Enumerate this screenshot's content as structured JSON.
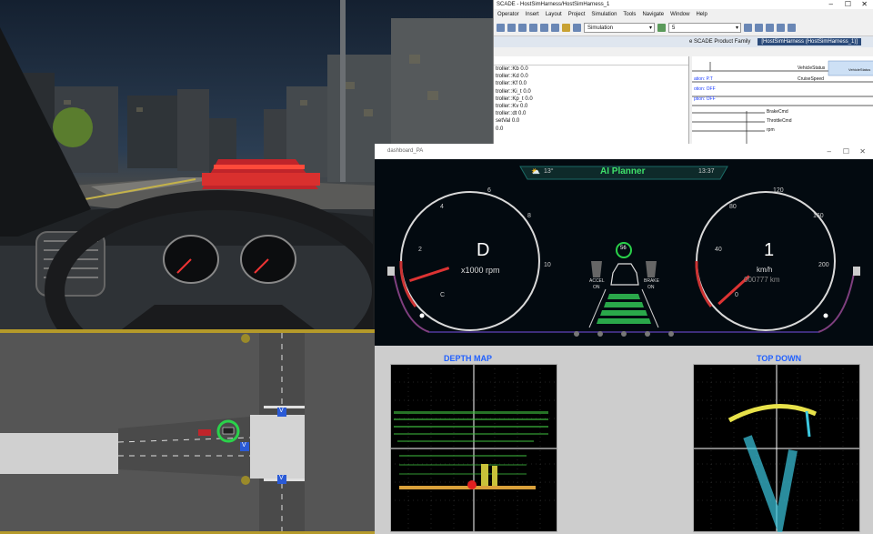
{
  "scade": {
    "title": "SCADE - HostSimHarness/HostSimHarness_1",
    "menu": [
      "Operator",
      "Insert",
      "Layout",
      "Project",
      "Simulation",
      "Tools",
      "Navigate",
      "Window",
      "Help"
    ],
    "mode_value": "Simulation",
    "speed_value": "5",
    "tabs": [
      "e SCADE Product Family",
      "[HostSimHarness (HostSimHarness_1)]"
    ],
    "variables": [
      "troller::Kb 0.0",
      "troller::Kd 0.0",
      "troller::Kf 0.0",
      "troller::Ki_t 0.0",
      "troller::Kp_t 0.0",
      "troller::Kv 0.0",
      "troller::dt 0.0",
      "setVal 0.0",
      "0.0"
    ],
    "signals_left": [
      "ation: P.T",
      "otion: OFF",
      "ption: OFF"
    ],
    "signals_right": [
      "VehicleStatus",
      "CruiseSpeed",
      "BrakeCmd",
      "ThrottleCmd",
      "rpm"
    ],
    "tooltip": "VehicleStatus"
  },
  "dashboard": {
    "window_title": "dashboard_PA",
    "weather_temp": "13°",
    "mode_label": "AI Planner",
    "clock": "13:37",
    "gear": "D",
    "rpm_unit": "x1000 rpm",
    "speed": "1",
    "speed_unit": "km/h",
    "odometer": "000777 km",
    "speed_limit": "56",
    "accel_label": "ACCEL",
    "accel_state": "ON",
    "brake_label": "BRAKE",
    "brake_state": "ON",
    "rpm_ticks": [
      "C",
      "2",
      "4",
      "6",
      "8",
      "10"
    ],
    "speed_ticks": [
      "0",
      "40",
      "80",
      "120",
      "160",
      "200"
    ],
    "rpm_fraction": 0.1,
    "speed_fraction": 0.01
  },
  "sensor": {
    "depth_title": "DEPTH MAP",
    "topdown_title": "TOP DOWN"
  },
  "map": {
    "lane_signs": [
      "V",
      "V",
      "V"
    ]
  }
}
